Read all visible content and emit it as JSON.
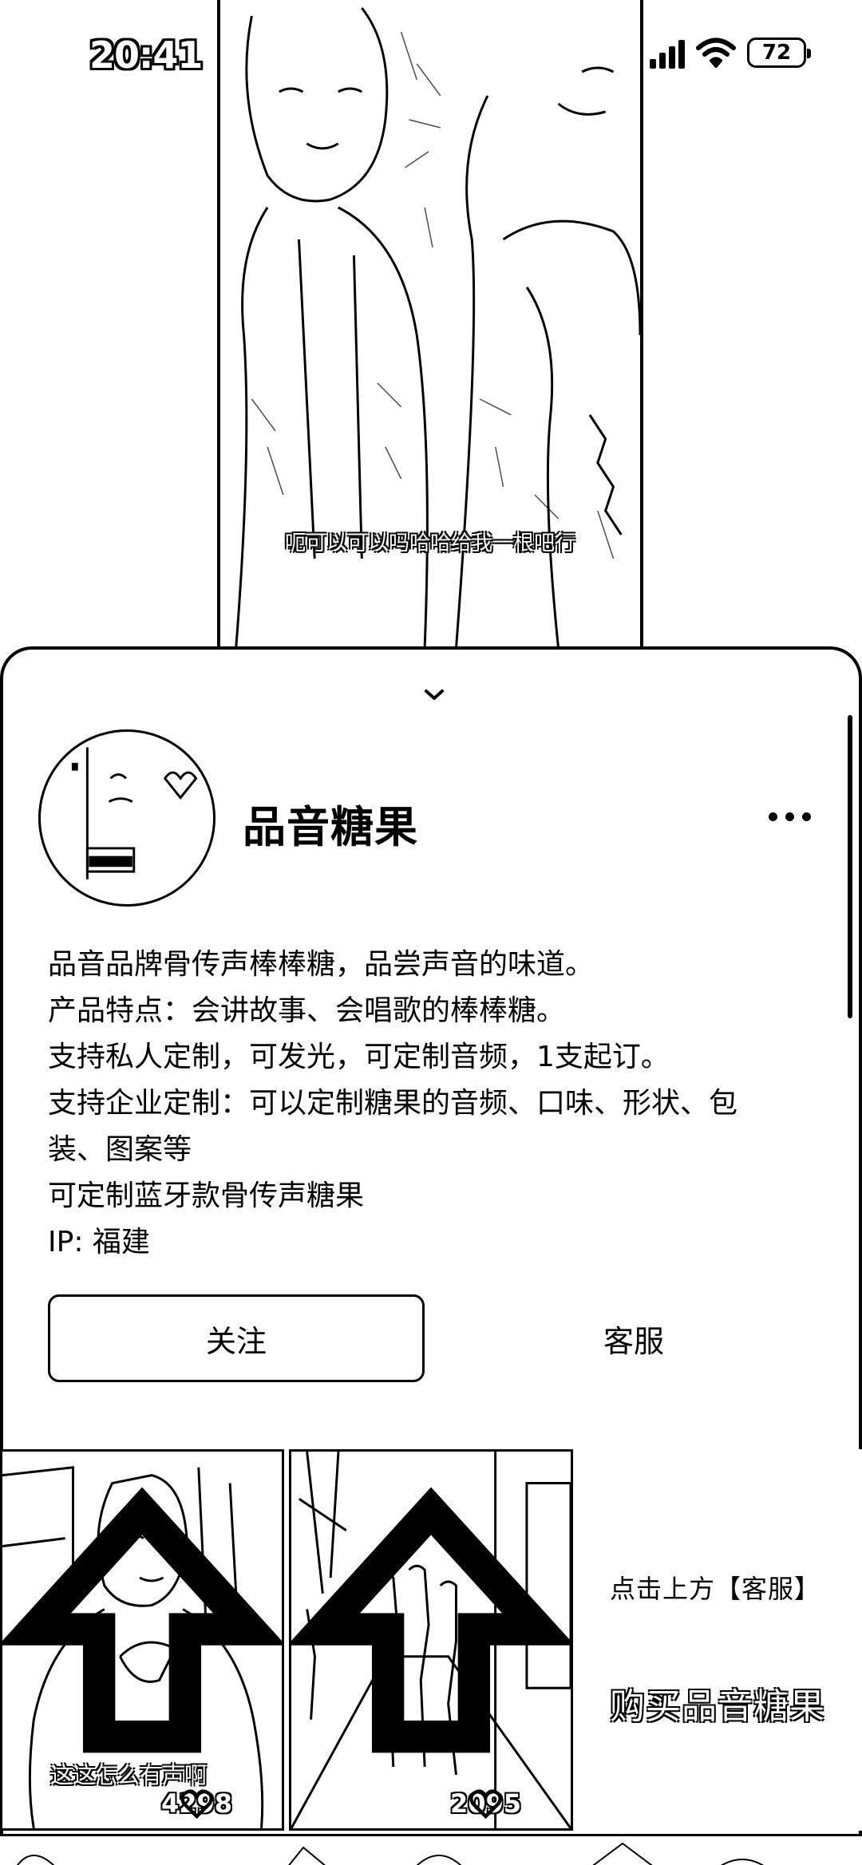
{
  "status_bar": {
    "time": "20:41",
    "battery": "72"
  },
  "video": {
    "subtitle": "呃可以可以吗哈哈给我一根吧行"
  },
  "profile": {
    "name": "品音糖果",
    "bio": [
      "品音品牌骨传声棒棒糖，品尝声音的味道。",
      "产品特点：会讲故事、会唱歌的棒棒糖。",
      "支持私人定制，可发光，可定制音频，1支起订。",
      "支持企业定制：可以定制糖果的音频、口味、形状、包",
      "装、图案等",
      "可定制蓝牙款骨传声糖果",
      "IP: 福建"
    ],
    "follow_label": "关注",
    "service_label": "客服"
  },
  "videos": [
    {
      "caption": "这这怎么有声啊",
      "likes": "4298"
    },
    {
      "caption": "",
      "likes": "2095"
    }
  ],
  "promo": {
    "line1": "点击上方【客服】",
    "line2": "购买品音糖果"
  }
}
